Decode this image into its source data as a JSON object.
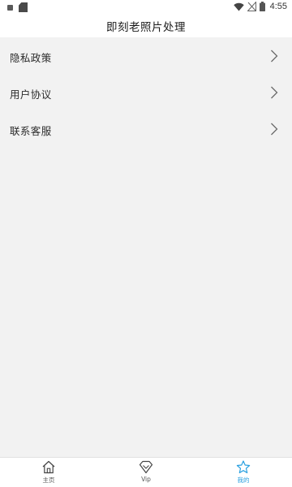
{
  "status_bar": {
    "time": "4:55",
    "icons": [
      "notification-icon",
      "sd-card-icon",
      "wifi-icon",
      "no-signal-icon",
      "battery-icon"
    ]
  },
  "header": {
    "title": "即刻老照片处理"
  },
  "menu": {
    "items": [
      {
        "label": "隐私政策",
        "icon": "chevron-right-icon"
      },
      {
        "label": "用户协议",
        "icon": "chevron-right-icon"
      },
      {
        "label": "联系客服",
        "icon": "chevron-right-icon"
      }
    ]
  },
  "bottom_nav": {
    "tabs": [
      {
        "label": "主页",
        "icon": "home-icon",
        "active": false
      },
      {
        "label": "Vip",
        "icon": "diamond-icon",
        "active": false
      },
      {
        "label": "我的",
        "icon": "star-icon",
        "active": true
      }
    ]
  },
  "colors": {
    "accent": "#2aa0e0",
    "background": "#f2f2f2",
    "bar_background": "#ffffff",
    "text": "#2b2b2b"
  }
}
